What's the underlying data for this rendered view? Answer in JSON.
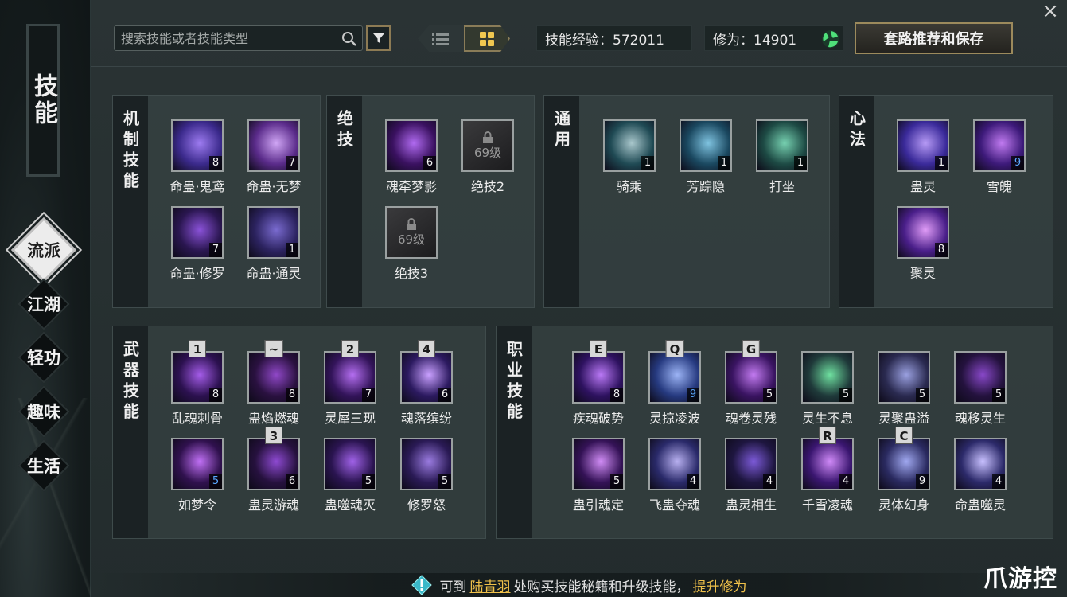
{
  "window": {
    "title": "技能",
    "close_symbol": "×"
  },
  "nav": {
    "items": [
      {
        "label": "流派",
        "active": true
      },
      {
        "label": "江湖",
        "active": false
      },
      {
        "label": "轻功",
        "active": false
      },
      {
        "label": "趣味",
        "active": false
      },
      {
        "label": "生活",
        "active": false
      }
    ]
  },
  "toolbar": {
    "search_placeholder": "搜索技能或者技能类型",
    "exp_label": "技能经验：572011",
    "cultivation_label": "修为：14901",
    "recommend_button": "套路推荐和保存"
  },
  "panels": {
    "mechanism": {
      "label": "机制技能",
      "skills": [
        {
          "name": "命蛊·鬼鸢",
          "level": "8",
          "colors": [
            "#3b2a8c",
            "#9d7bf0"
          ]
        },
        {
          "name": "命蛊·无梦",
          "level": "7",
          "colors": [
            "#5a2b8a",
            "#d0a6f5"
          ]
        },
        {
          "name": "命蛊·修罗",
          "level": "7",
          "colors": [
            "#2a1650",
            "#8a52d8"
          ]
        },
        {
          "name": "命蛊·通灵",
          "level": "1",
          "colors": [
            "#2c2360",
            "#7a6bd0"
          ]
        }
      ]
    },
    "ultimate": {
      "label": "绝技",
      "skills": [
        {
          "name": "魂牵梦影",
          "level": "6",
          "locked": false,
          "colors": [
            "#3a1160",
            "#b06af0"
          ]
        },
        {
          "name": "绝技2",
          "locked": true,
          "lock_text": "69级"
        },
        {
          "name": "绝技3",
          "locked": true,
          "lock_text": "69级"
        }
      ]
    },
    "general": {
      "label": "通用",
      "skills": [
        {
          "name": "骑乘",
          "level": "1",
          "colors": [
            "#1f4a54",
            "#a9c7cc"
          ]
        },
        {
          "name": "芳踪隐",
          "level": "1",
          "colors": [
            "#1a4860",
            "#7fc3e0"
          ]
        },
        {
          "name": "打坐",
          "level": "1",
          "colors": [
            "#1d4a44",
            "#76d0b0"
          ]
        }
      ]
    },
    "heart": {
      "label": "心法",
      "skills": [
        {
          "name": "蛊灵",
          "level": "1",
          "colors": [
            "#3a2a9a",
            "#b69af5"
          ]
        },
        {
          "name": "雪魄",
          "level": "9",
          "level_blue": true,
          "colors": [
            "#3d1a7a",
            "#c07af0"
          ]
        },
        {
          "name": "聚灵",
          "level": "8",
          "colors": [
            "#4a1f8a",
            "#e09cf7"
          ]
        }
      ]
    },
    "weapon": {
      "label": "武器技能",
      "skills": [
        {
          "name": "乱魂刺骨",
          "level": "8",
          "hotkey": "1",
          "colors": [
            "#2c1150",
            "#a45ce8"
          ]
        },
        {
          "name": "蛊焰燃魂",
          "level": "8",
          "hotkey": "~",
          "colors": [
            "#2a1140",
            "#9048c8"
          ]
        },
        {
          "name": "灵犀三现",
          "level": "7",
          "hotkey": "2",
          "colors": [
            "#33145a",
            "#b46ef0"
          ]
        },
        {
          "name": "魂落缤纷",
          "level": "6",
          "hotkey": "4",
          "colors": [
            "#2c1a60",
            "#c9a0ff"
          ]
        },
        {
          "name": "如梦令",
          "level": "5",
          "level_blue": true,
          "colors": [
            "#30114e",
            "#c070f5"
          ]
        },
        {
          "name": "蛊灵游魂",
          "level": "6",
          "hotkey": "3",
          "colors": [
            "#26113e",
            "#8e4ad2"
          ]
        },
        {
          "name": "蛊噬魂灭",
          "level": "5",
          "colors": [
            "#2a1450",
            "#a062e8"
          ]
        },
        {
          "name": "修罗怒",
          "level": "5",
          "colors": [
            "#2a1a55",
            "#9a7be0"
          ]
        }
      ]
    },
    "class": {
      "label": "职业技能",
      "skills": [
        {
          "name": "疾魂破势",
          "level": "8",
          "hotkey": "E",
          "colors": [
            "#2e1260",
            "#b978f5"
          ]
        },
        {
          "name": "灵掠凌波",
          "level": "9",
          "level_blue": true,
          "hotkey": "Q",
          "colors": [
            "#263a80",
            "#9cb4f5"
          ]
        },
        {
          "name": "魂卷灵残",
          "level": "5",
          "hotkey": "G",
          "colors": [
            "#3a1462",
            "#c27af0"
          ]
        },
        {
          "name": "灵生不息",
          "level": "5",
          "colors": [
            "#1f3a3a",
            "#6fe0a0"
          ]
        },
        {
          "name": "灵聚蛊溢",
          "level": "5",
          "colors": [
            "#2a2a50",
            "#9aa0e0"
          ]
        },
        {
          "name": "魂移灵生",
          "level": "5",
          "colors": [
            "#24123e",
            "#8848c8"
          ]
        },
        {
          "name": "蛊引魂定",
          "level": "5",
          "colors": [
            "#341256",
            "#d08cf5"
          ]
        },
        {
          "name": "飞蛊夺魂",
          "level": "4",
          "colors": [
            "#2a2a6a",
            "#b8b0f0"
          ]
        },
        {
          "name": "蛊灵相生",
          "level": "4",
          "colors": [
            "#1e1640",
            "#7c5ad8"
          ]
        },
        {
          "name": "千雪凌魂",
          "level": "4",
          "hotkey": "R",
          "colors": [
            "#3a1670",
            "#d08af8"
          ]
        },
        {
          "name": "灵体幻身",
          "level": "9",
          "hotkey": "C",
          "colors": [
            "#2a2a60",
            "#a0a8f0"
          ]
        },
        {
          "name": "命蛊噬灵",
          "level": "4",
          "colors": [
            "#2c2a6a",
            "#c8c0ff"
          ]
        }
      ]
    }
  },
  "footer": {
    "prefix": "可到",
    "npc_link": "陆青羽",
    "middle": "处购买技能秘籍和升级技能，",
    "cultivation_link": "提升修为"
  },
  "watermark": "爪游控"
}
